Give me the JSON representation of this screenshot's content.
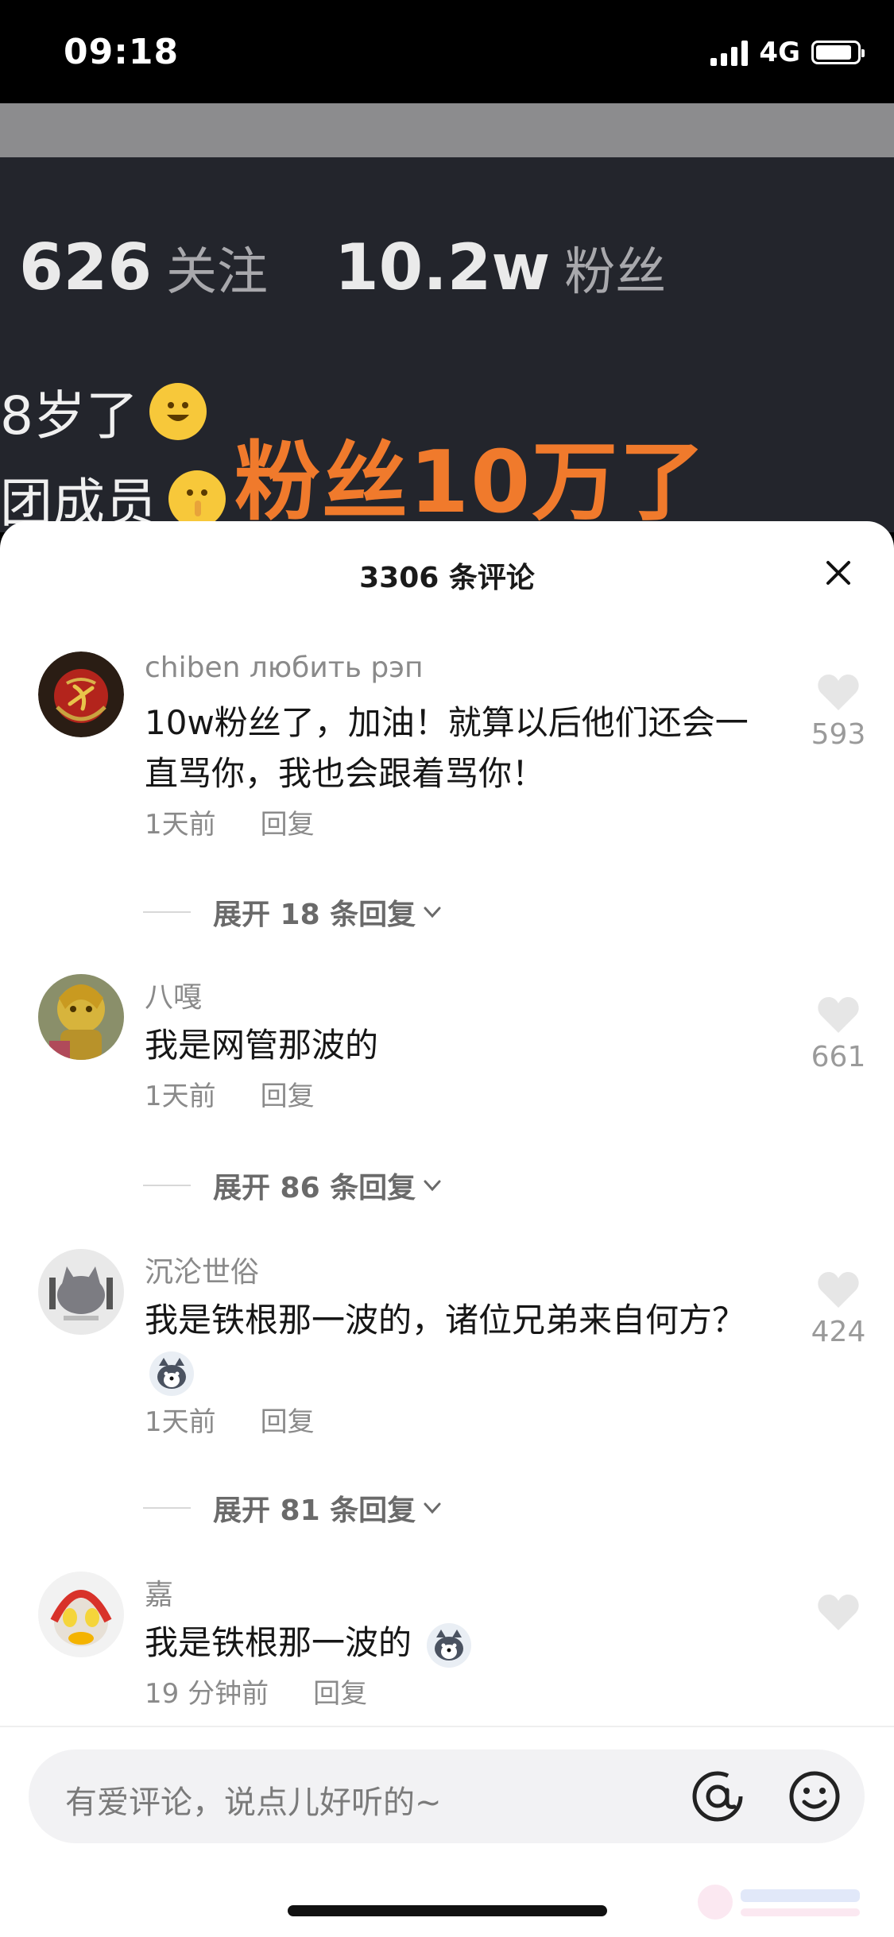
{
  "status_bar": {
    "time": "09:18",
    "network": "4G"
  },
  "profile": {
    "following_count": "626",
    "following_label": "关注",
    "followers_count": "10.2w",
    "followers_label": "粉丝",
    "bio_line1": "8岁了",
    "bio_line2": "团成员",
    "overlay_text": "粉丝10万了"
  },
  "comments_sheet": {
    "title": "3306 条评论",
    "comments": [
      {
        "username": "chiben любить рэп",
        "text": "10w粉丝了，加油！就算以后他们还会一直骂你，我也会跟着骂你！",
        "time": "1天前",
        "reply_label": "回复",
        "likes": "593",
        "expand_label": "展开 18 条回复"
      },
      {
        "username": "八嘎",
        "text": "我是网管那波的",
        "time": "1天前",
        "reply_label": "回复",
        "likes": "661",
        "expand_label": "展开 86 条回复"
      },
      {
        "username": "沉沦世俗",
        "text": "我是铁根那一波的，诸位兄弟来自何方？",
        "time": "1天前",
        "reply_label": "回复",
        "likes": "424",
        "expand_label": "展开 81 条回复"
      },
      {
        "username": "嘉",
        "text": "我是铁根那一波的",
        "time": "19 分钟前",
        "reply_label": "回复",
        "likes": ""
      }
    ]
  },
  "input": {
    "placeholder": "有爱评论，说点儿好听的~"
  },
  "icons": {
    "close": "close-icon",
    "like": "heart-icon",
    "expand": "chevron-down-icon",
    "at": "at-icon",
    "emoji": "smile-icon"
  }
}
